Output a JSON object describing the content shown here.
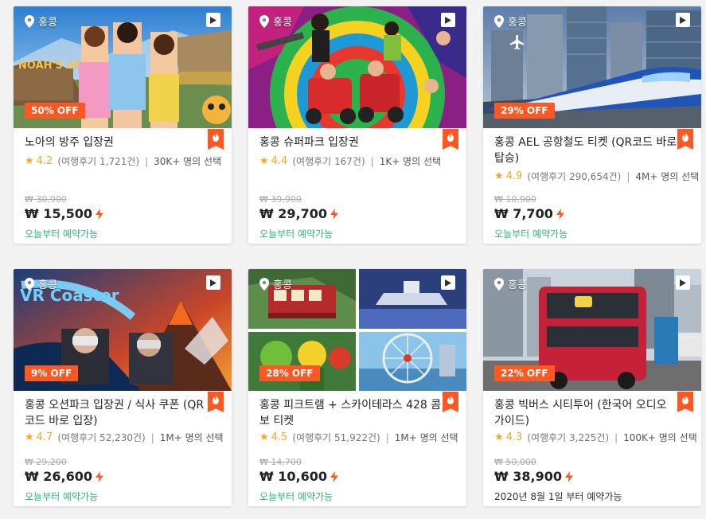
{
  "colors": {
    "accent": "#ff5722",
    "star": "#f5a623",
    "available": "#2db47c"
  },
  "icons": {
    "location": "map-pin-icon",
    "video": "play-icon",
    "hot": "fire-icon",
    "instant": "lightning-bolt-icon",
    "airport": "airplane-icon"
  },
  "products": [
    {
      "location": "홍콩",
      "discount": "50% OFF",
      "title": "노아의 방주 입장권",
      "rating": "4.2",
      "reviews": "(여행후기 1,721건)",
      "selected": "30K+ 명의 선택",
      "original_price": "₩ 30,900",
      "price": "₩ 15,500",
      "availability": "오늘부터 예약가능"
    },
    {
      "location": "홍콩",
      "discount": "",
      "title": "홍콩 슈퍼파크 입장권",
      "rating": "4.4",
      "reviews": "(여행후기 167건)",
      "selected": "1K+ 명의 선택",
      "original_price": "₩ 39,900",
      "price": "₩ 29,700",
      "availability": "오늘부터 예약가능"
    },
    {
      "location": "홍콩",
      "discount": "29% OFF",
      "title": "홍콩 AEL 공항철도 티켓 (QR코드 바로 탑승)",
      "rating": "4.9",
      "reviews": "(여행후기 290,654건)",
      "selected": "4M+ 명의 선택",
      "original_price": "₩ 10,900",
      "price": "₩ 7,700",
      "availability": "오늘부터 예약가능"
    },
    {
      "location": "홍콩",
      "discount": "9% OFF",
      "title": "홍콩 오션파크 입장권 / 식사 쿠폰 (QR코드 바로 입장)",
      "rating": "4.7",
      "reviews": "(여행후기 52,230건)",
      "selected": "1M+ 명의 선택",
      "original_price": "₩ 29,200",
      "price": "₩ 26,600",
      "availability": "오늘부터 예약가능"
    },
    {
      "location": "홍콩",
      "discount": "28% OFF",
      "title": "홍콩 피크트램 + 스카이테라스 428 콤보 티켓",
      "rating": "4.5",
      "reviews": "(여행후기 51,922건)",
      "selected": "1M+ 명의 선택",
      "original_price": "₩ 14,700",
      "price": "₩ 10,600",
      "availability": "오늘부터 예약가능"
    },
    {
      "location": "홍콩",
      "discount": "22% OFF",
      "title": "홍콩 빅버스 시티투어 (한국어 오디오 가이드)",
      "rating": "4.3",
      "reviews": "(여행후기 3,225건)",
      "selected": "100K+ 명의 선택",
      "original_price": "₩ 50,000",
      "price": "₩ 38,900",
      "availability": "2020년 8월 1일 부터 예약가능"
    }
  ]
}
